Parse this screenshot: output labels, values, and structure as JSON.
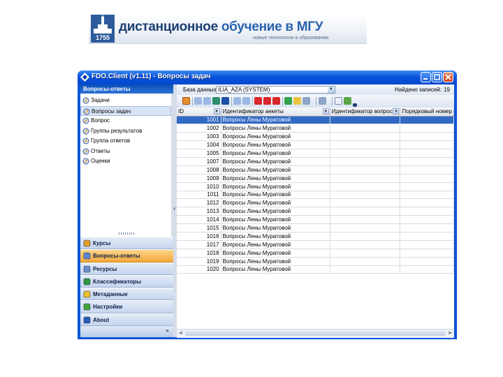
{
  "banner": {
    "year": "1755",
    "title_part1": "дистанционное",
    "title_part2": "обучение в",
    "title_part3": "МГУ",
    "subtitle": "новые технологии в образовании"
  },
  "window": {
    "title": "FDO.Client (v1.11) - Вопросы задач"
  },
  "left_panel": {
    "header": "Вопросы-ответы",
    "tree_items": [
      {
        "label": "Задачи",
        "selected": false
      },
      {
        "label": "Вопросы задач",
        "selected": true
      },
      {
        "label": "Вопрос",
        "selected": false
      },
      {
        "label": "Группы результатов",
        "selected": false
      },
      {
        "label": "Группа ответов",
        "selected": false
      },
      {
        "label": "Ответы",
        "selected": false
      },
      {
        "label": "Оценки",
        "selected": false
      }
    ],
    "nav_buttons": [
      {
        "label": "Курсы",
        "icon": "courses-icon",
        "active": false
      },
      {
        "label": "Вопросы-ответы",
        "icon": "qa-icon",
        "active": true
      },
      {
        "label": "Ресурсы",
        "icon": "resources-icon",
        "active": false
      },
      {
        "label": "Классификаторы",
        "icon": "filter-icon",
        "active": false
      },
      {
        "label": "Метаданные",
        "icon": "star-icon",
        "active": false
      },
      {
        "label": "Настройки",
        "icon": "settings-icon",
        "active": false
      },
      {
        "label": "About",
        "icon": "help-icon",
        "active": false
      }
    ]
  },
  "filter": {
    "label": "База данных",
    "value": "ILIA_AZA (SYSTEM)",
    "found_label": "Найдено записей:",
    "found_count": "19"
  },
  "grid": {
    "columns": [
      "ID",
      "Идентификатор анкеты",
      "Идентификатор вопроса",
      "Порядковый номер"
    ],
    "rows": [
      {
        "id": "1001",
        "survey": "Вопросы Лены Муратовой",
        "question": "",
        "order": ""
      },
      {
        "id": "1002",
        "survey": "Вопросы Лены Муратовой",
        "question": "",
        "order": ""
      },
      {
        "id": "1003",
        "survey": "Вопросы Лены Муратовой",
        "question": "",
        "order": ""
      },
      {
        "id": "1004",
        "survey": "Вопросы Лены Муратовой",
        "question": "",
        "order": ""
      },
      {
        "id": "1005",
        "survey": "Вопросы Лены Муратовой",
        "question": "",
        "order": ""
      },
      {
        "id": "1007",
        "survey": "Вопросы Лены Муратовой",
        "question": "",
        "order": ""
      },
      {
        "id": "1008",
        "survey": "Вопросы Лены Муратовой",
        "question": "",
        "order": ""
      },
      {
        "id": "1009",
        "survey": "Вопросы Лены Муратовой",
        "question": "",
        "order": ""
      },
      {
        "id": "1010",
        "survey": "Вопросы Лены Муратовой",
        "question": "",
        "order": ""
      },
      {
        "id": "1011",
        "survey": "Вопросы Лены Муратовой",
        "question": "",
        "order": ""
      },
      {
        "id": "1012",
        "survey": "Вопросы Лены Муратовой",
        "question": "",
        "order": ""
      },
      {
        "id": "1013",
        "survey": "Вопросы Лены Муратовой",
        "question": "",
        "order": ""
      },
      {
        "id": "1014",
        "survey": "Вопросы Лены Муратовой",
        "question": "",
        "order": ""
      },
      {
        "id": "1015",
        "survey": "Вопросы Лены Муратовой",
        "question": "",
        "order": ""
      },
      {
        "id": "1016",
        "survey": "Вопросы Лены Муратовой",
        "question": "",
        "order": ""
      },
      {
        "id": "1017",
        "survey": "Вопросы Лены Муратовой",
        "question": "",
        "order": ""
      },
      {
        "id": "1018",
        "survey": "Вопросы Лены Муратовой",
        "question": "",
        "order": ""
      },
      {
        "id": "1019",
        "survey": "Вопросы Лены Муратовой",
        "question": "",
        "order": ""
      },
      {
        "id": "1020",
        "survey": "Вопросы Лены Муратовой",
        "question": "",
        "order": ""
      }
    ],
    "selected_row": 0
  },
  "colors": {
    "titlebar": "#0754dc",
    "active_nav": "#f3a83b",
    "selection": "#316ac5"
  }
}
